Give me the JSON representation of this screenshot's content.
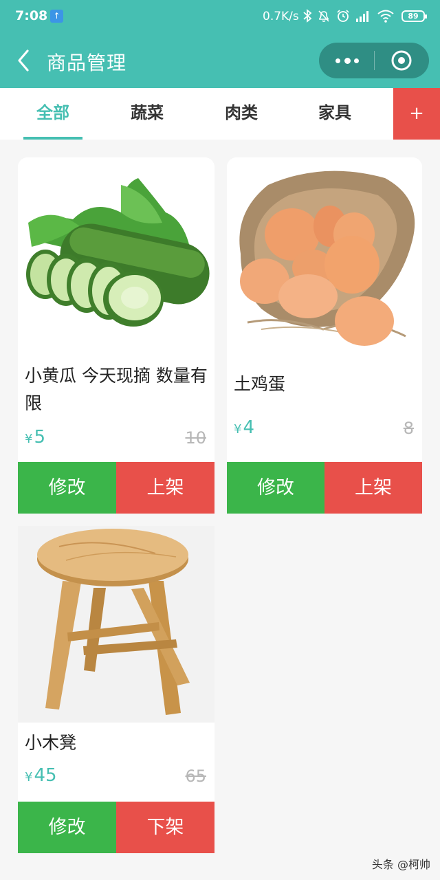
{
  "status_bar": {
    "time": "7:08",
    "speed": "0.7K/s",
    "battery": "89"
  },
  "nav": {
    "title": "商品管理"
  },
  "tabs": [
    {
      "label": "全部",
      "active": true
    },
    {
      "label": "蔬菜",
      "active": false
    },
    {
      "label": "肉类",
      "active": false
    },
    {
      "label": "家具",
      "active": false
    }
  ],
  "add_tab_label": "+",
  "products": [
    {
      "name": "小黄瓜 今天现摘 数量有限",
      "currency": "¥",
      "price": "5",
      "old_price": "10",
      "edit_label": "修改",
      "shelf_label": "上架",
      "image_icon": "cucumber-image"
    },
    {
      "name": "土鸡蛋",
      "currency": "¥",
      "price": "4",
      "old_price": "8",
      "edit_label": "修改",
      "shelf_label": "上架",
      "image_icon": "eggs-image"
    },
    {
      "name": "小木凳",
      "currency": "¥",
      "price": "45",
      "old_price": "65",
      "edit_label": "修改",
      "shelf_label": "下架",
      "image_icon": "stool-image"
    }
  ],
  "watermark": "头条 @柯帅",
  "colors": {
    "primary": "#46bfb2",
    "green_button": "#3bb54a",
    "red_button": "#e8504a"
  }
}
